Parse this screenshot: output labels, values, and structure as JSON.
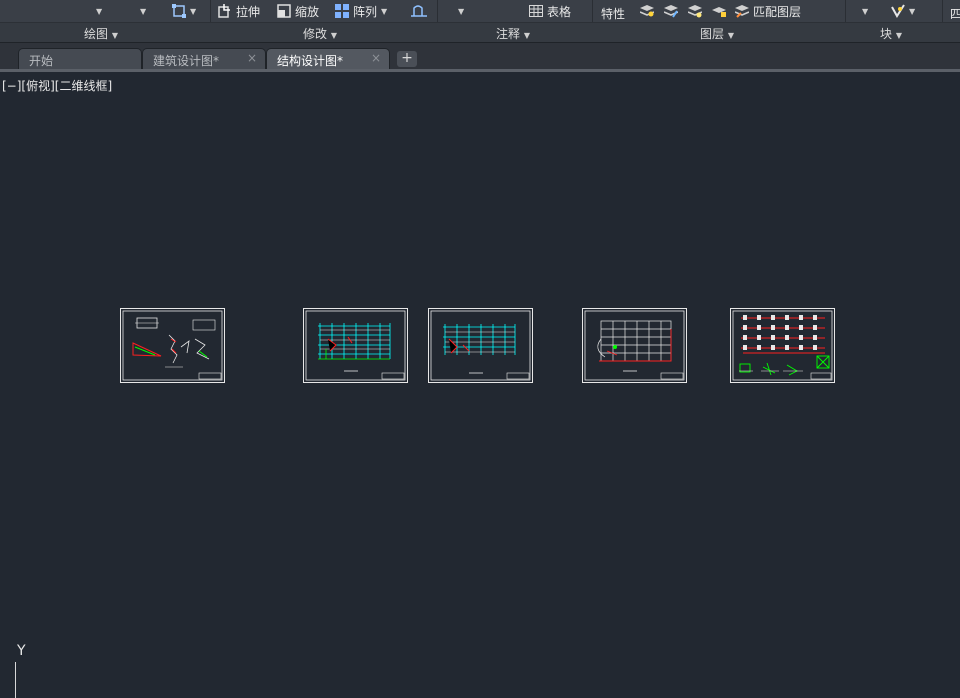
{
  "ribbon": {
    "tools": {
      "stretch": "拉伸",
      "scale": "缩放",
      "array": "阵列",
      "table": "表格",
      "properties": "特性",
      "match_layer": "匹配图层",
      "partial": "四"
    },
    "panels": {
      "draw": "绘图",
      "modify": "修改",
      "annotate": "注释",
      "layers": "图层",
      "block": "块"
    }
  },
  "tabs": [
    {
      "label": "开始",
      "active": false
    },
    {
      "label": "建筑设计图*",
      "active": false
    },
    {
      "label": "结构设计图*",
      "active": true
    }
  ],
  "tab_close_glyph": "×",
  "tab_add_glyph": "+",
  "viewport": {
    "label": "[−][俯视][二维线框]"
  },
  "ucs": {
    "y_axis": "Y"
  },
  "colors": {
    "canvas_bg": "#222831",
    "ribbon_bg": "#3a3f47",
    "cad_white": "#e8e8e8",
    "cad_cyan": "#00ffff",
    "cad_red": "#ff2020",
    "cad_green": "#00ff00",
    "cad_magenta": "#ff00ff"
  }
}
